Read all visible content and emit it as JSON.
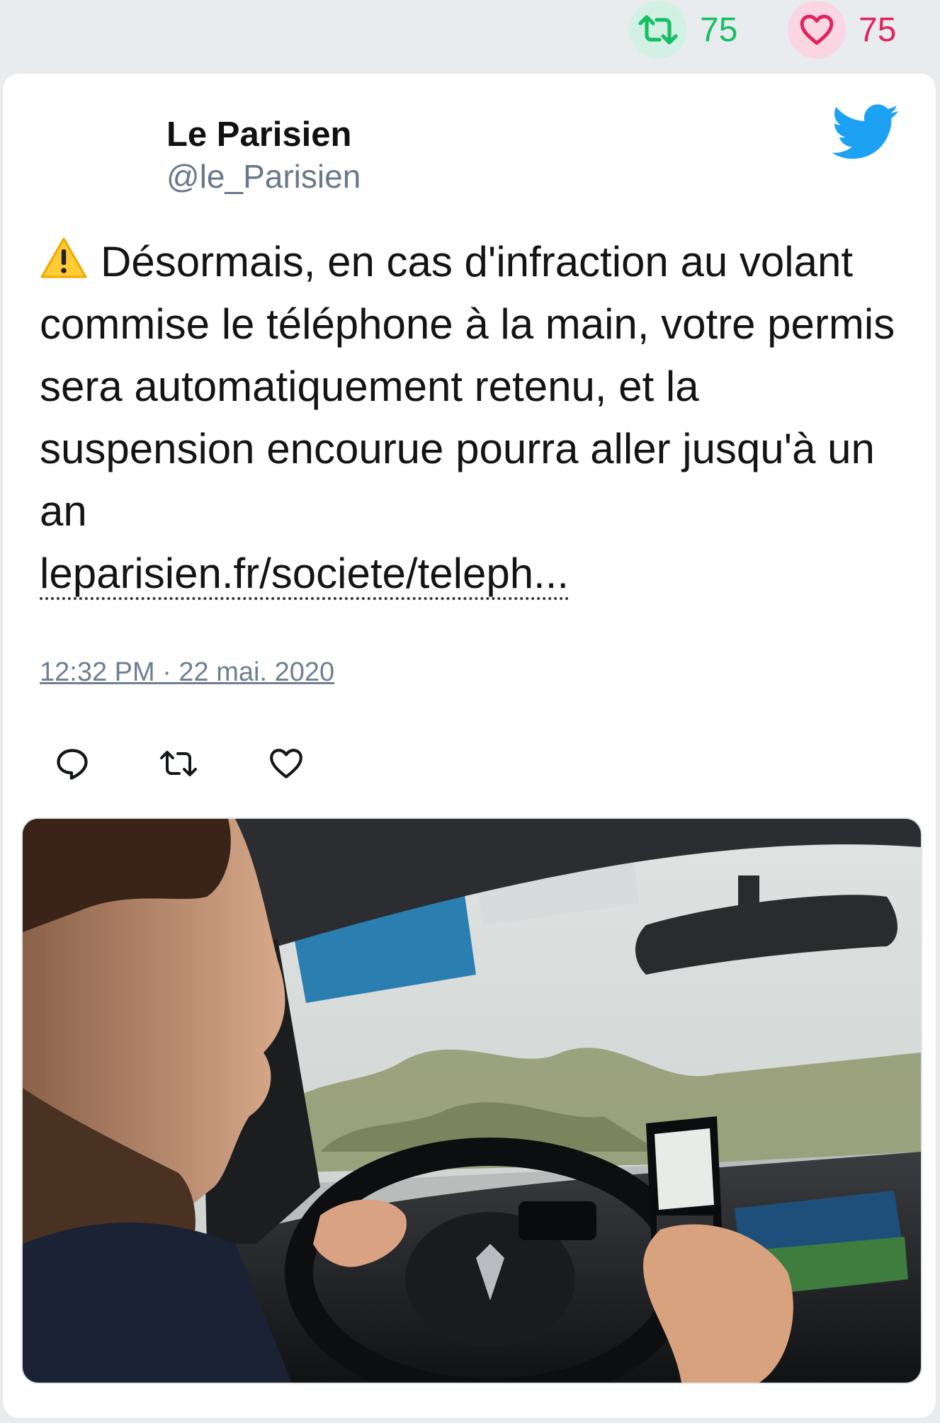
{
  "stats": {
    "retweet_count": "75",
    "like_count": "75",
    "retweet_icon": "retweet-icon",
    "like_icon": "heart-icon"
  },
  "tweet": {
    "author_name": "Le Parisien",
    "author_handle": "@le_Parisien",
    "text": "Désormais, en cas d'infraction au volant commise le téléphone à la main, votre permis sera automatiquement retenu, et la suspension encourue pourra aller jusqu'à un an",
    "link_text": "leparisien.fr/societe/teleph...",
    "timestamp": "12:32 PM · 22 mai. 2020",
    "leading_icon": "warning-icon",
    "brand_icon": "twitter-bird-icon"
  },
  "actions": [
    "reply-icon",
    "retweet-icon",
    "like-icon"
  ],
  "media": {
    "description_icon": "photo-driver-using-phone"
  },
  "colors": {
    "retweet_green": "#17bf63",
    "like_pink": "#e0245e",
    "twitter_blue": "#1da1f2",
    "handle_gray": "#69788a"
  }
}
